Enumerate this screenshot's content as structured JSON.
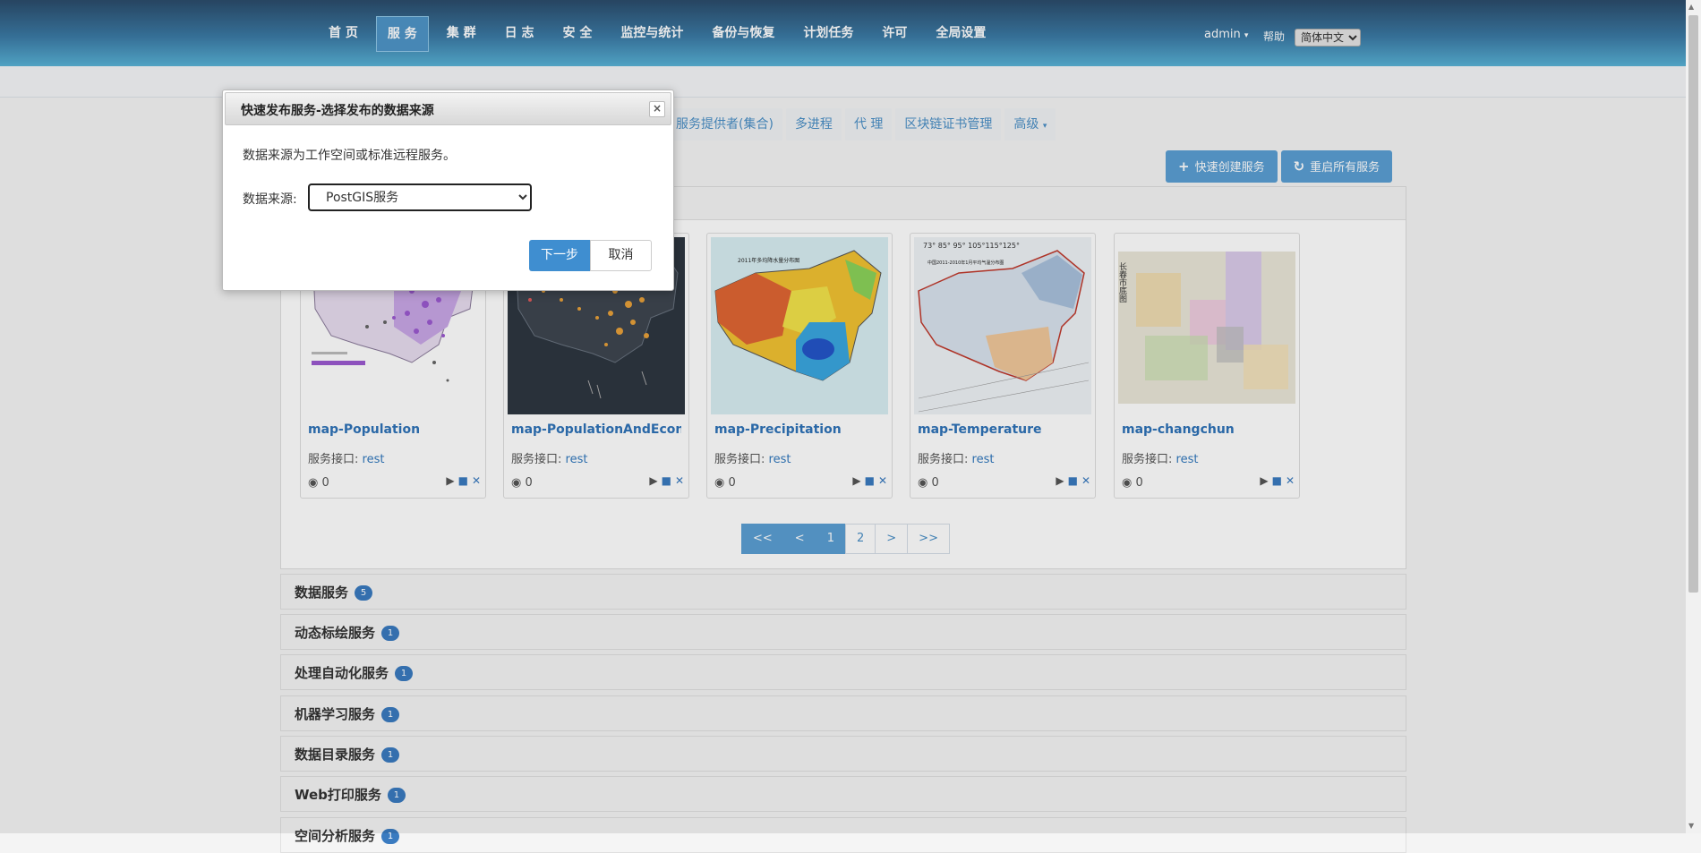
{
  "topnav": {
    "items": [
      "首 页",
      "服 务",
      "集 群",
      "日 志",
      "安 全",
      "监控与统计",
      "备份与恢复",
      "计划任务",
      "许可",
      "全局设置"
    ],
    "active": "服 务",
    "user": "admin",
    "help": "帮助",
    "language": "简体中文"
  },
  "tabs": [
    "服务提供者(集合)",
    "多进程",
    "代 理",
    "区块链证书管理",
    "高级"
  ],
  "actions": {
    "quick_create": "快速创建服务",
    "restart_all": "重启所有服务"
  },
  "cards": [
    {
      "title": "map-Population",
      "iface_label": "服务接口:",
      "iface_link": "rest",
      "views": "0"
    },
    {
      "title": "map-PopulationAndEcono...",
      "iface_label": "服务接口:",
      "iface_link": "rest",
      "views": "0"
    },
    {
      "title": "map-Precipitation",
      "iface_label": "服务接口:",
      "iface_link": "rest",
      "views": "0"
    },
    {
      "title": "map-Temperature",
      "iface_label": "服务接口:",
      "iface_link": "rest",
      "views": "0"
    },
    {
      "title": "map-changchun",
      "iface_label": "服务接口:",
      "iface_link": "rest",
      "views": "0"
    }
  ],
  "map_labels": {
    "precip_title": "2011年多均降水量分布图",
    "temp_title": "中国2011-2010年1月平均气温分布图",
    "temp_lon": "73° 85° 95° 105°115°125°",
    "changchun_title": "长春市底图"
  },
  "pagination": [
    "<<",
    "<",
    "1",
    "2",
    ">",
    ">>"
  ],
  "sections": [
    {
      "label": "数据服务",
      "count": "5"
    },
    {
      "label": "动态标绘服务",
      "count": "1"
    },
    {
      "label": "处理自动化服务",
      "count": "1"
    },
    {
      "label": "机器学习服务",
      "count": "1"
    },
    {
      "label": "数据目录服务",
      "count": "1"
    },
    {
      "label": "Web打印服务",
      "count": "1"
    },
    {
      "label": "空间分析服务",
      "count": "1"
    }
  ],
  "dialog": {
    "title": "快速发布服务-选择发布的数据来源",
    "description": "数据来源为工作空间或标准远程服务。",
    "source_label": "数据来源:",
    "source_value": "PostGIS服务",
    "next": "下一步",
    "cancel": "取消"
  }
}
